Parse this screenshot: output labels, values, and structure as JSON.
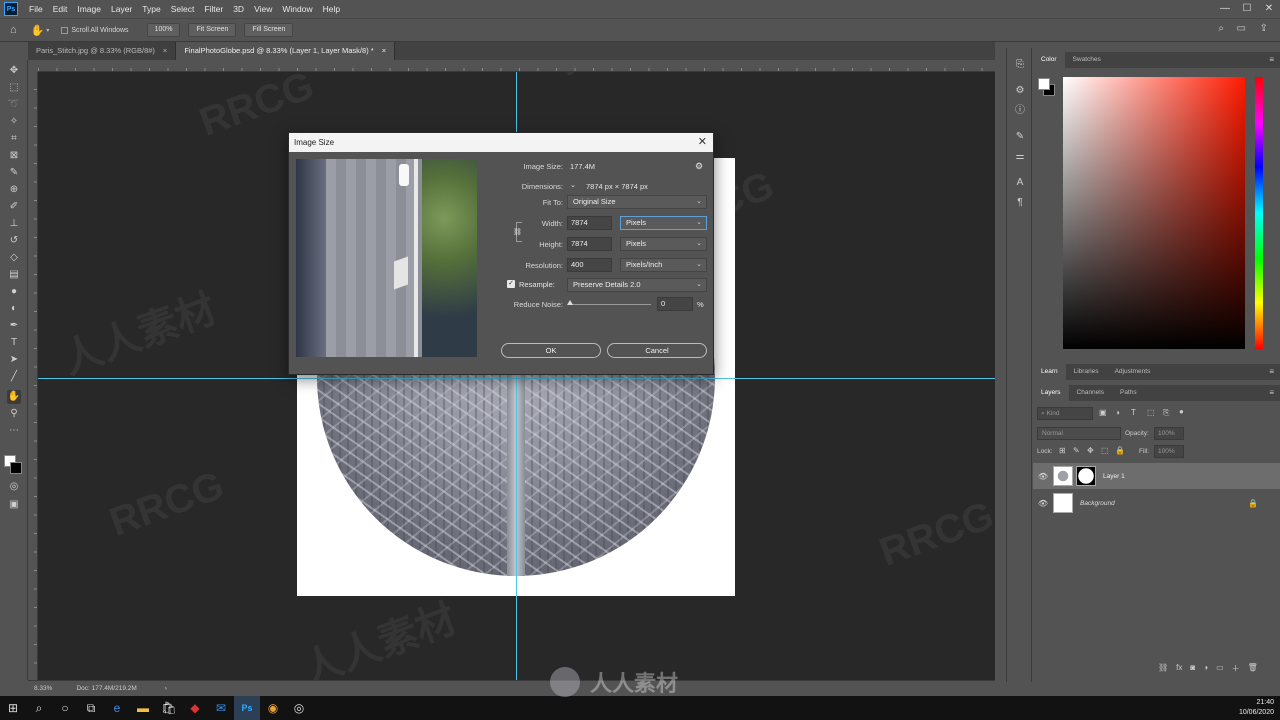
{
  "menubar": {
    "logo": "Ps",
    "items": [
      "File",
      "Edit",
      "Image",
      "Layer",
      "Type",
      "Select",
      "Filter",
      "3D",
      "View",
      "Window",
      "Help"
    ],
    "window_controls": [
      "—",
      "☐",
      "✕"
    ]
  },
  "options": {
    "scroll_all_windows": "Scroll All Windows",
    "zoom_value": "100%",
    "fit_screen": "Fit Screen",
    "fill_screen": "Fill Screen"
  },
  "tabs": [
    {
      "label": "Paris_Stitch.jpg @ 8.33% (RGB/8#)",
      "active": false
    },
    {
      "label": "FinalPhotoGlobe.psd @ 8.33% (Layer 1, Layer Mask/8) *",
      "active": true
    }
  ],
  "status": {
    "zoom": "8.33%",
    "doc": "Doc: 177.4M/219.2M"
  },
  "dialog": {
    "title": "Image Size",
    "image_size_label": "Image Size:",
    "image_size_value": "177.4M",
    "dimensions_label": "Dimensions:",
    "dimensions_value": "7874 px  ×  7874 px",
    "fit_to_label": "Fit To:",
    "fit_to_value": "Original Size",
    "width_label": "Width:",
    "width_value": "7874",
    "width_unit": "Pixels",
    "height_label": "Height:",
    "height_value": "7874",
    "height_unit": "Pixels",
    "resolution_label": "Resolution:",
    "resolution_value": "400",
    "resolution_unit": "Pixels/Inch",
    "resample_label": "Resample:",
    "resample_value": "Preserve Details 2.0",
    "reduce_noise_label": "Reduce Noise:",
    "reduce_noise_value": "0",
    "reduce_noise_unit": "%",
    "ok": "OK",
    "cancel": "Cancel"
  },
  "color_panel": {
    "tabs": [
      "Color",
      "Swatches"
    ],
    "foreground": "#ffffff",
    "background": "#000000"
  },
  "learn_panel": {
    "tabs": [
      "Learn",
      "Libraries",
      "Adjustments"
    ]
  },
  "layers_panel": {
    "tabs": [
      "Layers",
      "Channels",
      "Paths"
    ],
    "kind_placeholder": "Kind",
    "blend_mode": "Normal",
    "opacity_label": "Opacity:",
    "opacity_value": "100%",
    "lock_label": "Lock:",
    "fill_label": "Fill:",
    "fill_value": "100%",
    "layers": [
      {
        "name": "Layer 1",
        "selected": true
      },
      {
        "name": "Background",
        "selected": false
      }
    ]
  },
  "taskbar": {
    "time": "21:40",
    "date": "10/06/2020"
  },
  "watermarks": [
    "RRCG",
    "人人素材"
  ]
}
